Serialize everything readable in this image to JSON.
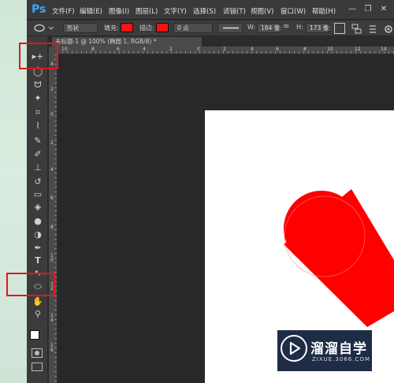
{
  "app": {
    "logo": "Ps",
    "menu": [
      "文件(F)",
      "编辑(E)",
      "图像(I)",
      "图层(L)",
      "文字(Y)",
      "选择(S)",
      "滤镜(T)",
      "视图(V)",
      "窗口(W)",
      "帮助(H)"
    ],
    "window_controls": {
      "minimize": "—",
      "restore": "❐",
      "close": "✕"
    }
  },
  "options_bar": {
    "tool_icon": "ellipse-tool-icon",
    "mode_value": "形状",
    "fill_label": "填充:",
    "fill_color": "#ff1010",
    "stroke_label": "描边:",
    "stroke_color": "#ff1010",
    "stroke_width": "0 点",
    "w_label": "W:",
    "w_value": "184 像:",
    "link_icon": "∞",
    "h_label": "H:",
    "h_value": "173 像:"
  },
  "document": {
    "tab_title": "未标题-1 @ 100% (椭圆 1, RGB/8) *",
    "ruler_top_labels": [
      "10",
      "8",
      "6",
      "4",
      "2",
      "0",
      "2",
      "4",
      "6",
      "8",
      "10",
      "12",
      "14"
    ],
    "ruler_left_labels": [
      "4",
      "2",
      "0",
      "2",
      "4",
      "6",
      "8",
      "1 0",
      "1 2",
      "1 4",
      "1 6"
    ]
  },
  "canvas": {
    "background": "#ffffff",
    "shape_color": "#ff0000"
  },
  "tools": [
    {
      "name": "move-tool-icon",
      "glyph": "▸+"
    },
    {
      "name": "marquee-ellipse-tool-icon",
      "glyph": "◯"
    },
    {
      "name": "lasso-tool-icon",
      "glyph": "ᗢ"
    },
    {
      "name": "magic-wand-tool-icon",
      "glyph": "✦"
    },
    {
      "name": "crop-tool-icon",
      "glyph": "⌗"
    },
    {
      "name": "eyedropper-tool-icon",
      "glyph": "⌇"
    },
    {
      "name": "healing-brush-tool-icon",
      "glyph": "✎"
    },
    {
      "name": "brush-tool-icon",
      "glyph": "✐"
    },
    {
      "name": "clone-stamp-tool-icon",
      "glyph": "⊥"
    },
    {
      "name": "history-brush-tool-icon",
      "glyph": "↺"
    },
    {
      "name": "eraser-tool-icon",
      "glyph": "▭"
    },
    {
      "name": "paint-bucket-tool-icon",
      "glyph": "◈"
    },
    {
      "name": "blur-tool-icon",
      "glyph": "●"
    },
    {
      "name": "dodge-tool-icon",
      "glyph": "◑"
    },
    {
      "name": "pen-tool-icon",
      "glyph": "✒"
    },
    {
      "name": "type-tool-icon",
      "glyph": "T"
    },
    {
      "name": "path-selection-tool-icon",
      "glyph": "↖"
    },
    {
      "name": "ellipse-tool-icon",
      "glyph": "⬭"
    },
    {
      "name": "hand-tool-icon",
      "glyph": "✋"
    },
    {
      "name": "zoom-tool-icon",
      "glyph": "⚲"
    }
  ],
  "watermark": {
    "title": "溜溜自学",
    "subtitle": "ZIXUE.3066.COM"
  }
}
